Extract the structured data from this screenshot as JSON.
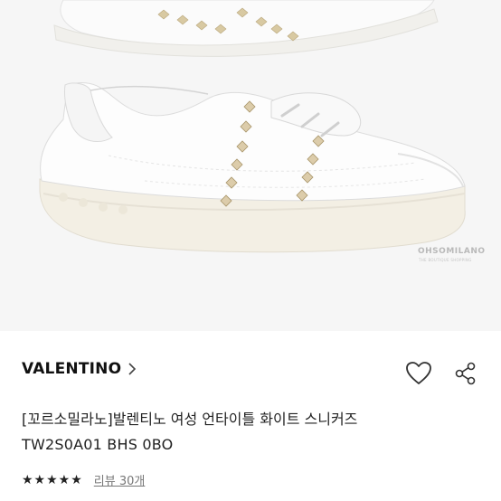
{
  "product": {
    "brand": "VALENTINO",
    "title_line1": "[꼬르소밀라노]발렌티노 여성 언타이틀 화이트 스니커즈",
    "title_line2": "TW2S0A01 BHS 0BO",
    "stars": "★★★★★",
    "review_link": "리뷰 30개"
  },
  "image": {
    "watermark": "OHSOMILANO",
    "watermark_sub": "THE BOUTIQUE SHOPPING"
  },
  "icons": {
    "like": "heart-icon",
    "share": "share-icon",
    "brand_link": "chevron-right-icon"
  }
}
